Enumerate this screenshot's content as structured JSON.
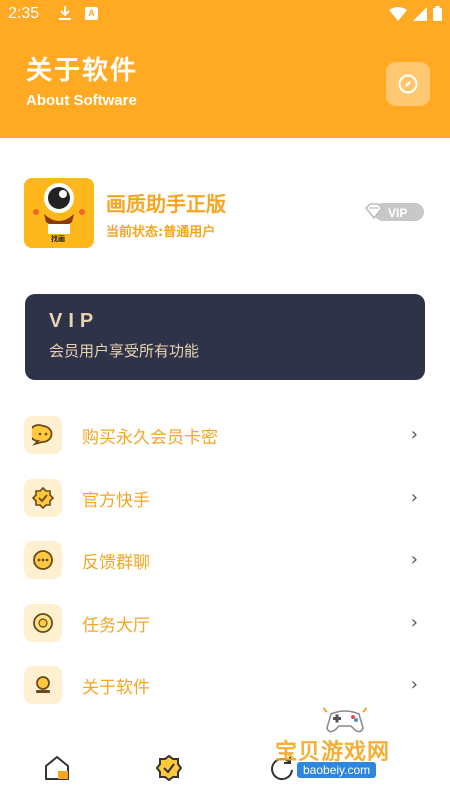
{
  "status_bar": {
    "time": "2:35",
    "notif_a": "A"
  },
  "header": {
    "title": "关于软件",
    "subtitle": "About Software",
    "colors": {
      "primary": "#FFAA22"
    }
  },
  "profile": {
    "app_name": "画质助手正版",
    "status_text": "当前状态:普通用户",
    "vip_badge": "VIP",
    "avatar_label": "找画"
  },
  "vip_card": {
    "title": "VIP",
    "description": "会员用户享受所有功能"
  },
  "menu": {
    "items": [
      {
        "label": "购买永久会员卡密",
        "icon": "chat-bubble-icon"
      },
      {
        "label": "官方快手",
        "icon": "verified-badge-icon"
      },
      {
        "label": "反馈群聊",
        "icon": "dots-bubble-icon"
      },
      {
        "label": "任务大厅",
        "icon": "task-circle-icon"
      },
      {
        "label": "关于软件",
        "icon": "about-icon"
      }
    ],
    "chevron": "›"
  },
  "tabbar": {
    "tabs": [
      "home-icon",
      "verified-badge-icon",
      "refresh-icon"
    ]
  },
  "watermark": {
    "text": "宝贝游戏网",
    "url": "baobeiy.com"
  }
}
